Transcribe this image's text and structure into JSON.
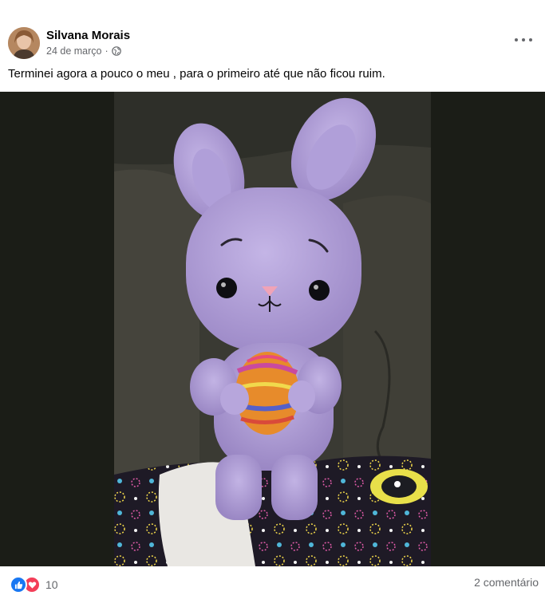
{
  "post": {
    "author": "Silvana Morais",
    "date": "24 de março",
    "separator": "·",
    "privacy_icon": "globe-icon",
    "more_icon": "more-options-icon",
    "caption": "Terminei agora a pouco o meu , para o primeiro até que não ficou ruim.",
    "photo_subject": "crochet-bunny-photo"
  },
  "footer": {
    "reaction_icons": [
      "like-icon",
      "love-icon"
    ],
    "reaction_count": "10",
    "comments_label": "2 comentário"
  },
  "colors": {
    "like": "#1877f2",
    "love": "#f33e58",
    "secondary_text": "#65676b",
    "bunny": "#b7a6dc"
  }
}
